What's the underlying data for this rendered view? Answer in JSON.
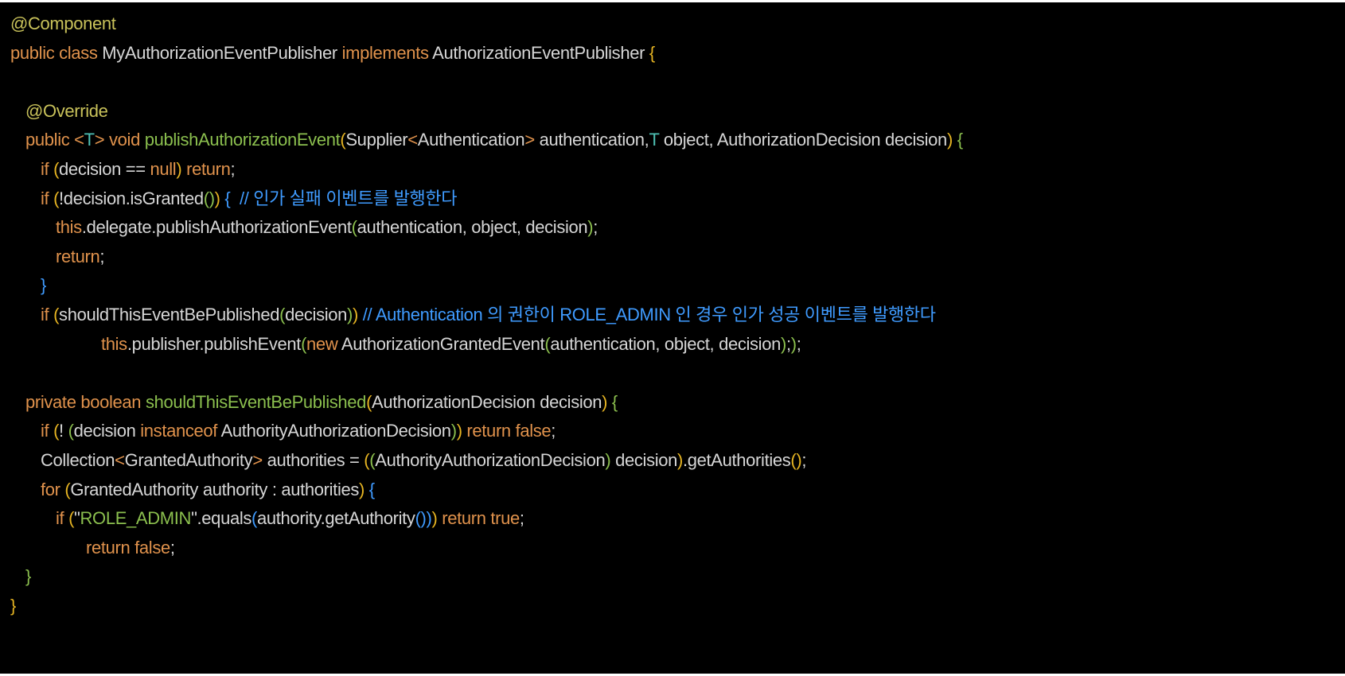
{
  "colors": {
    "background": "#000000",
    "plain": "#d6d6d6",
    "keyword": "#e0924c",
    "annotation": "#c9c25a",
    "method": "#8bbf4e",
    "type_param": "#4ec1b4",
    "comment": "#3f9bff",
    "string": "#8bbf4e",
    "bracket_gold": "#e6b422",
    "bracket_green": "#8bbf4e",
    "bracket_blue": "#3f9bff"
  },
  "code": {
    "language": "Java",
    "lines": [
      {
        "indent": 0,
        "tokens": [
          {
            "t": "@Component",
            "c": "annotation"
          }
        ]
      },
      {
        "indent": 0,
        "tokens": [
          {
            "t": "public class ",
            "c": "keyword"
          },
          {
            "t": "MyAuthorizationEventPublisher ",
            "c": "plain"
          },
          {
            "t": "implements ",
            "c": "keyword"
          },
          {
            "t": "AuthorizationEventPublisher ",
            "c": "plain"
          },
          {
            "t": "{",
            "c": "bracket_gold"
          }
        ]
      },
      {
        "indent": 0,
        "tokens": []
      },
      {
        "indent": 1,
        "tokens": [
          {
            "t": "@Override",
            "c": "annotation"
          }
        ]
      },
      {
        "indent": 1,
        "tokens": [
          {
            "t": "public ",
            "c": "keyword"
          },
          {
            "t": "<",
            "c": "keyword"
          },
          {
            "t": "T",
            "c": "type_param"
          },
          {
            "t": ">",
            "c": "keyword"
          },
          {
            "t": " void ",
            "c": "keyword"
          },
          {
            "t": "publishAuthorizationEvent",
            "c": "method"
          },
          {
            "t": "(",
            "c": "bracket_gold"
          },
          {
            "t": "Supplier",
            "c": "plain"
          },
          {
            "t": "<",
            "c": "keyword"
          },
          {
            "t": "Authentication",
            "c": "plain"
          },
          {
            "t": ">",
            "c": "keyword"
          },
          {
            "t": " authentication,",
            "c": "plain"
          },
          {
            "t": "T",
            "c": "type_param"
          },
          {
            "t": " object, AuthorizationDecision decision",
            "c": "plain"
          },
          {
            "t": ")",
            "c": "bracket_gold"
          },
          {
            "t": " {",
            "c": "bracket_green"
          }
        ]
      },
      {
        "indent": 2,
        "tokens": [
          {
            "t": "if ",
            "c": "keyword"
          },
          {
            "t": "(",
            "c": "bracket_gold"
          },
          {
            "t": "decision == ",
            "c": "plain"
          },
          {
            "t": "null",
            "c": "keyword"
          },
          {
            "t": ")",
            "c": "bracket_gold"
          },
          {
            "t": " return",
            "c": "keyword"
          },
          {
            "t": ";",
            "c": "plain"
          }
        ]
      },
      {
        "indent": 2,
        "tokens": [
          {
            "t": "if ",
            "c": "keyword"
          },
          {
            "t": "(",
            "c": "bracket_gold"
          },
          {
            "t": "!decision.isGranted",
            "c": "plain"
          },
          {
            "t": "()",
            "c": "bracket_green"
          },
          {
            "t": ")",
            "c": "bracket_gold"
          },
          {
            "t": " {",
            "c": "bracket_blue"
          },
          {
            "t": "  // 인가 실패 이벤트를 발행한다",
            "c": "comment"
          }
        ]
      },
      {
        "indent": 3,
        "tokens": [
          {
            "t": "this",
            "c": "keyword"
          },
          {
            "t": ".delegate.publishAuthorizationEvent",
            "c": "plain"
          },
          {
            "t": "(",
            "c": "bracket_green"
          },
          {
            "t": "authentication, object, decision",
            "c": "plain"
          },
          {
            "t": ")",
            "c": "bracket_green"
          },
          {
            "t": ";",
            "c": "plain"
          }
        ]
      },
      {
        "indent": 3,
        "tokens": [
          {
            "t": "return",
            "c": "keyword"
          },
          {
            "t": ";",
            "c": "plain"
          }
        ]
      },
      {
        "indent": 2,
        "tokens": [
          {
            "t": "}",
            "c": "bracket_blue"
          }
        ]
      },
      {
        "indent": 2,
        "tokens": [
          {
            "t": "if ",
            "c": "keyword"
          },
          {
            "t": "(",
            "c": "bracket_gold"
          },
          {
            "t": "shouldThisEventBePublished",
            "c": "plain"
          },
          {
            "t": "(",
            "c": "bracket_green"
          },
          {
            "t": "decision",
            "c": "plain"
          },
          {
            "t": ")",
            "c": "bracket_green"
          },
          {
            "t": ")",
            "c": "bracket_gold"
          },
          {
            "t": " // Authentication 의 권한이 ROLE_ADMIN 인 경우 인가 성공 이벤트를 발행한다",
            "c": "comment"
          }
        ]
      },
      {
        "indent": 6,
        "tokens": [
          {
            "t": "this",
            "c": "keyword"
          },
          {
            "t": ".publisher.publishEvent",
            "c": "plain"
          },
          {
            "t": "(",
            "c": "bracket_green"
          },
          {
            "t": "new ",
            "c": "keyword"
          },
          {
            "t": "AuthorizationGrantedEvent",
            "c": "plain"
          },
          {
            "t": "(",
            "c": "bracket_green"
          },
          {
            "t": "authentication, object, decision",
            "c": "plain"
          },
          {
            "t": ")",
            "c": "bracket_green"
          },
          {
            "t": ";",
            "c": "plain"
          },
          {
            "t": ")",
            "c": "bracket_green"
          },
          {
            "t": ";",
            "c": "plain"
          }
        ]
      },
      {
        "indent": 0,
        "tokens": []
      },
      {
        "indent": 1,
        "tokens": [
          {
            "t": "private boolean ",
            "c": "keyword"
          },
          {
            "t": "shouldThisEventBePublished",
            "c": "method"
          },
          {
            "t": "(",
            "c": "bracket_gold"
          },
          {
            "t": "AuthorizationDecision decision",
            "c": "plain"
          },
          {
            "t": ")",
            "c": "bracket_gold"
          },
          {
            "t": " {",
            "c": "bracket_green"
          }
        ]
      },
      {
        "indent": 2,
        "tokens": [
          {
            "t": "if ",
            "c": "keyword"
          },
          {
            "t": "(",
            "c": "bracket_gold"
          },
          {
            "t": "! ",
            "c": "plain"
          },
          {
            "t": "(",
            "c": "bracket_green"
          },
          {
            "t": "decision ",
            "c": "plain"
          },
          {
            "t": "instanceof ",
            "c": "keyword"
          },
          {
            "t": "AuthorityAuthorizationDecision",
            "c": "plain"
          },
          {
            "t": ")",
            "c": "bracket_green"
          },
          {
            "t": ")",
            "c": "bracket_gold"
          },
          {
            "t": " return false",
            "c": "keyword"
          },
          {
            "t": ";",
            "c": "plain"
          }
        ]
      },
      {
        "indent": 2,
        "tokens": [
          {
            "t": "Collection",
            "c": "plain"
          },
          {
            "t": "<",
            "c": "keyword"
          },
          {
            "t": "GrantedAuthority",
            "c": "plain"
          },
          {
            "t": ">",
            "c": "keyword"
          },
          {
            "t": " authorities = ",
            "c": "plain"
          },
          {
            "t": "(",
            "c": "bracket_gold"
          },
          {
            "t": "(",
            "c": "bracket_green"
          },
          {
            "t": "AuthorityAuthorizationDecision",
            "c": "plain"
          },
          {
            "t": ")",
            "c": "bracket_green"
          },
          {
            "t": " decision",
            "c": "plain"
          },
          {
            "t": ")",
            "c": "bracket_gold"
          },
          {
            "t": ".getAuthorities",
            "c": "plain"
          },
          {
            "t": "()",
            "c": "bracket_gold"
          },
          {
            "t": ";",
            "c": "plain"
          }
        ]
      },
      {
        "indent": 2,
        "tokens": [
          {
            "t": "for ",
            "c": "keyword"
          },
          {
            "t": "(",
            "c": "bracket_gold"
          },
          {
            "t": "GrantedAuthority authority : authorities",
            "c": "plain"
          },
          {
            "t": ")",
            "c": "bracket_gold"
          },
          {
            "t": " {",
            "c": "bracket_blue"
          }
        ]
      },
      {
        "indent": 3,
        "tokens": [
          {
            "t": "if ",
            "c": "keyword"
          },
          {
            "t": "(",
            "c": "bracket_gold"
          },
          {
            "t": "\"",
            "c": "plain"
          },
          {
            "t": "ROLE_ADMIN",
            "c": "string"
          },
          {
            "t": "\"",
            "c": "plain"
          },
          {
            "t": ".equals",
            "c": "plain"
          },
          {
            "t": "(",
            "c": "bracket_blue"
          },
          {
            "t": "authority.getAuthority",
            "c": "plain"
          },
          {
            "t": "()",
            "c": "bracket_blue"
          },
          {
            "t": ")",
            "c": "bracket_blue"
          },
          {
            "t": ")",
            "c": "bracket_gold"
          },
          {
            "t": " return true",
            "c": "keyword"
          },
          {
            "t": ";",
            "c": "plain"
          }
        ]
      },
      {
        "indent": 5,
        "tokens": [
          {
            "t": "return false",
            "c": "keyword"
          },
          {
            "t": ";",
            "c": "plain"
          }
        ]
      },
      {
        "indent": 1,
        "tokens": [
          {
            "t": "}",
            "c": "bracket_green"
          }
        ]
      },
      {
        "indent": 0,
        "tokens": [
          {
            "t": "}",
            "c": "bracket_gold"
          }
        ]
      }
    ]
  }
}
